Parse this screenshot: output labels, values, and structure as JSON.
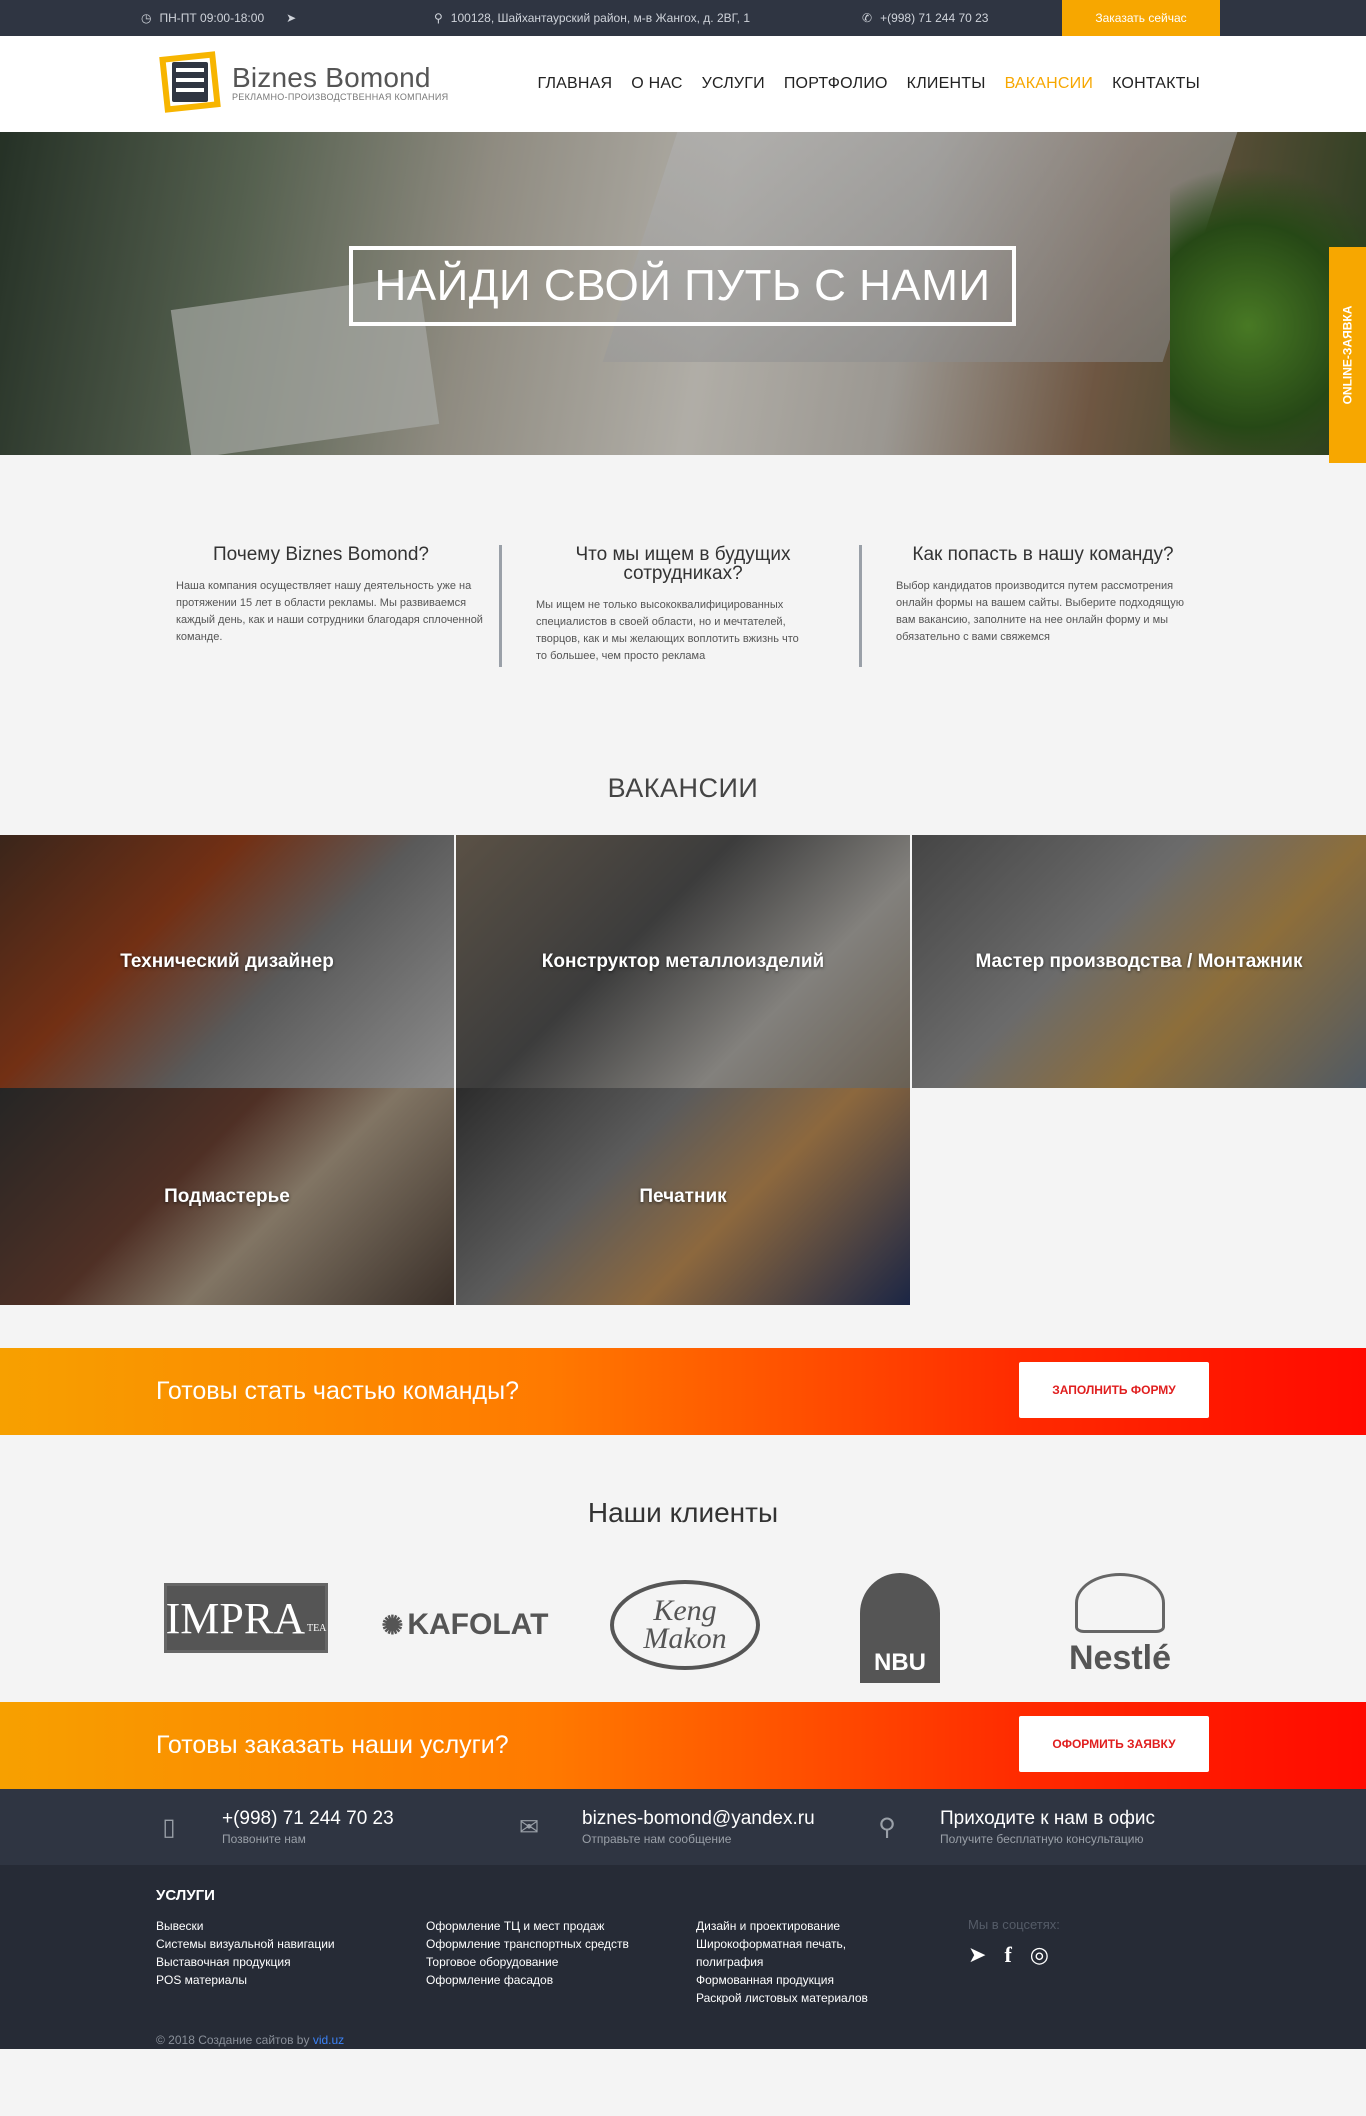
{
  "topbar": {
    "hours": "ПН-ПТ 09:00-18:00",
    "address": "100128, Шайхантаурский район, м-в Жангох, д. 2ВГ, 1",
    "phone": "+(998) 71 244 70 23",
    "cta": "Заказать сейчас"
  },
  "logo": {
    "name": "Biznes Bomond",
    "tagline": "РЕКЛАМНО-ПРОИЗВОДСТВЕННАЯ КОМПАНИЯ",
    "mark_text": "BIZNES BOMOND"
  },
  "nav": [
    "ГЛАВНАЯ",
    "О НАС",
    "УСЛУГИ",
    "ПОРТФОЛИО",
    "КЛИЕНТЫ",
    "ВАКАНСИИ",
    "КОНТАКТЫ"
  ],
  "nav_active": "ВАКАНСИИ",
  "hero": {
    "title": "НАЙДИ СВОЙ ПУТЬ С НАМИ"
  },
  "side_tab": "ONLINE-ЗАЯВКА",
  "info": [
    {
      "title": "Почему Biznes Bomond?",
      "text": "Наша компания осуществляет нашу деятельность уже на протяжении 15 лет в области рекламы. Мы развиваемся каждый день, как и наши сотрудники благодаря сплоченной команде."
    },
    {
      "title": "Что мы ищем в будущих сотрудниках?",
      "text": "Мы ищем не только высококвалифицированных специалистов в своей области, но и мечтателей, творцов, как и мы желающих воплотить вжизнь что то большее, чем просто реклама"
    },
    {
      "title": "Как попасть в нашу команду?",
      "text": "Выбор кандидатов производится путем рассмотрения онлайн формы на вашем сайты. Выберите подходящую вам вакансию, заполните на нее онлайн форму и мы обязательно с вами свяжемся"
    }
  ],
  "vacancies": {
    "title": "ВАКАНСИИ",
    "items": [
      "Технический дизайнер",
      "Конструктор металлоизделий",
      "Мастер производства / Монтажник",
      "Подмастерье",
      "Печатник"
    ]
  },
  "cta1": {
    "title": "Готовы стать частью команды?",
    "button": "ЗАПОЛНИТЬ ФОРМУ"
  },
  "clients": {
    "title": "Наши клиенты",
    "logos": {
      "impra": "IMPRA",
      "impra_sub": "TEA",
      "kafolat": "KAFOLAT",
      "keng": "Keng Makon",
      "nbu": "NBU",
      "nestle": "Nestlé"
    }
  },
  "cta2": {
    "title": "Готовы заказать наши услуги?",
    "button": "ОФОРМИТЬ ЗАЯВКУ"
  },
  "contacts": [
    {
      "icon": "phone-icon",
      "main": "+(998) 71 244 70 23",
      "sub": "Позвоните нам"
    },
    {
      "icon": "mail-icon",
      "main": "biznes-bomond@yandex.ru",
      "sub": "Отправьте нам сообщение"
    },
    {
      "icon": "location-icon",
      "main": "Приходите к нам в офис",
      "sub": "Получите бесплатную консультацию"
    }
  ],
  "footer": {
    "services_title": "УСЛУГИ",
    "col1": [
      "Вывески",
      "Системы визуальной навигации",
      "Выставочная продукция",
      "POS материалы"
    ],
    "col2": [
      "Оформление ТЦ и мест продаж",
      "Оформление транспортных средств",
      "Торговое оборудование",
      "Оформление фасадов"
    ],
    "col3": [
      "Дизайн и проектирование",
      "Широкоформатная печать, полиграфия",
      "Формованная продукция",
      "Раскрой листовых материалов"
    ],
    "social_label": "Мы в соцсетях:",
    "copyright": "© 2018 Создание сайтов by",
    "copyright_link": "vid.uz"
  },
  "colors": {
    "accent": "#f7a700",
    "dark": "#2f3542",
    "cta_red": "#ff0a00"
  }
}
